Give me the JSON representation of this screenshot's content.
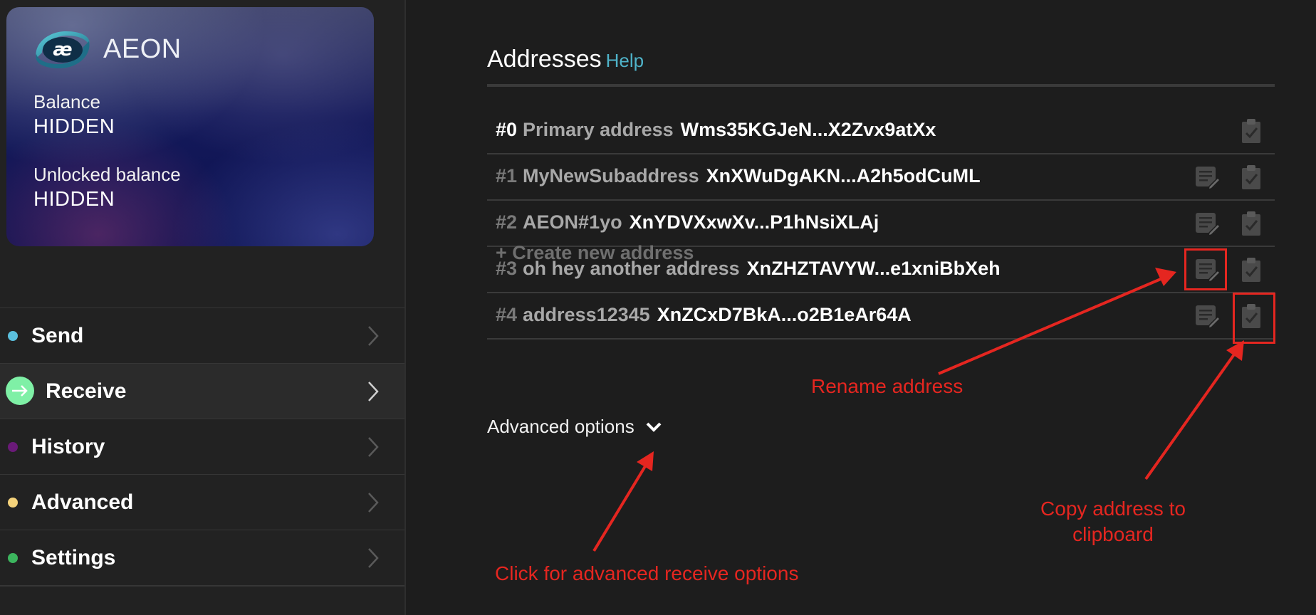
{
  "wallet_card": {
    "logo_text": "AEON",
    "balance_label": "Balance",
    "balance_value": "HIDDEN",
    "unlocked_label": "Unlocked balance",
    "unlocked_value": "HIDDEN"
  },
  "menu": [
    {
      "label": "Send",
      "color": "#5bc0de",
      "icon": "dot"
    },
    {
      "label": "Receive",
      "color": "#7ff0a6",
      "icon": "arrow-right-icon",
      "active": true
    },
    {
      "label": "History",
      "color": "#6a1a78",
      "icon": "dot"
    },
    {
      "label": "Advanced",
      "color": "#f5d37b",
      "icon": "dot"
    },
    {
      "label": "Settings",
      "color": "#3cb55e",
      "icon": "dot"
    }
  ],
  "addresses": {
    "title": "Addresses",
    "help": "Help",
    "items": [
      {
        "index": "#0",
        "label": "Primary address",
        "address": "Wms35KGJeN...X2Zvx9atXx"
      },
      {
        "index": "#1",
        "label": "MyNewSubaddress",
        "address": "XnXWuDgAKN...A2h5odCuML"
      },
      {
        "index": "#2",
        "label": "AEON#1yo",
        "address": "XnYDVXxwXv...P1hNsiXLAj"
      },
      {
        "index": "#3",
        "label": "oh hey another address",
        "address": "XnZHZTAVYW...e1xniBbXeh"
      },
      {
        "index": "#4",
        "label": "address12345",
        "address": "XnZCxD7BkA...o2B1eAr64A"
      }
    ],
    "create_label": "+ Create new address"
  },
  "advanced_options": {
    "label": "Advanced options"
  },
  "annotations": {
    "rename": "Rename address",
    "copy_line1": "Copy address to",
    "copy_line2": "clipboard",
    "advanced": "Click for advanced receive options",
    "color": "#e52620"
  },
  "colors": {
    "background": "#1d1d1d",
    "sidebar": "#222222",
    "accent": "#4fb3c9"
  }
}
